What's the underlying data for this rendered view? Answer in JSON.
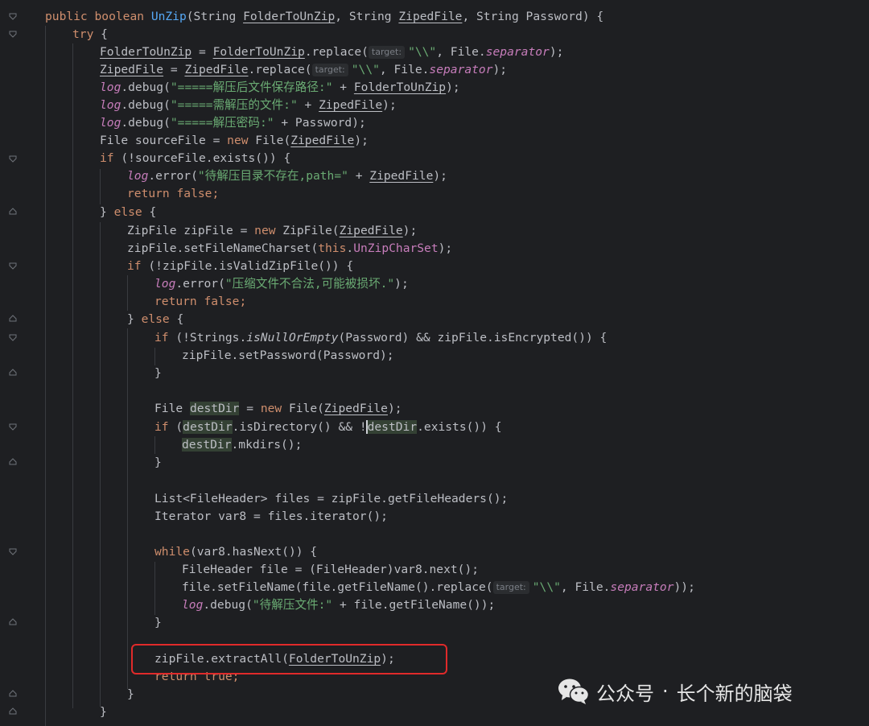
{
  "code": {
    "l1": {
      "kw1": "public",
      "kw2": "boolean",
      "fn": "UnZip",
      "p1": "(String ",
      "a1": "FolderToUnZip",
      "p2": ", String ",
      "a2": "ZipedFile",
      "p3": ", String Password) {"
    },
    "l2": {
      "kw": "try",
      "rest": " {"
    },
    "l3": {
      "v1": "FolderToUnZip",
      "p1": " = ",
      "v2": "FolderToUnZip",
      "p2": ".replace(",
      "hint": "target:",
      "s": "\"\\\\\"",
      "p3": ", File.",
      "f": "separator",
      "p4": ");"
    },
    "l4": {
      "v1": "ZipedFile",
      "p1": " = ",
      "v2": "ZipedFile",
      "p2": ".replace(",
      "hint": "target:",
      "s": "\"\\\\\"",
      "p3": ", File.",
      "f": "separator",
      "p4": ");"
    },
    "l5": {
      "log": "log",
      "m": ".debug(",
      "s": "\"=====解压后文件保存路径:\"",
      "p": " + ",
      "v": "FolderToUnZip",
      "e": ");"
    },
    "l6": {
      "log": "log",
      "m": ".debug(",
      "s": "\"=====需解压的文件:\"",
      "p": " + ",
      "v": "ZipedFile",
      "e": ");"
    },
    "l7": {
      "log": "log",
      "m": ".debug(",
      "s": "\"=====解压密码:\"",
      "p": " + Password);"
    },
    "l8": {
      "p1": "File sourceFile = ",
      "kw": "new",
      "p2": " File(",
      "v": "ZipedFile",
      "e": ");"
    },
    "l9": {
      "kw": "if",
      "p": " (!sourceFile.exists()) {"
    },
    "l10": {
      "log": "log",
      "m": ".error(",
      "s": "\"待解压目录不存在,path=\"",
      "p": " + ",
      "v": "ZipedFile",
      "e": ");"
    },
    "l11": {
      "kw1": "return",
      "kw2": "false",
      "e": ";"
    },
    "l12": {
      "p1": "} ",
      "kw": "else",
      "p2": " {"
    },
    "l13": {
      "p1": "ZipFile zipFile = ",
      "kw": "new",
      "p2": " ZipFile(",
      "v": "ZipedFile",
      "e": ");"
    },
    "l14": {
      "p1": "zipFile.setFileNameCharset(",
      "kw": "this",
      "p2": ".",
      "f": "UnZipCharSet",
      "e": ");"
    },
    "l15": {
      "kw": "if",
      "p": " (!zipFile.isValidZipFile()) {"
    },
    "l16": {
      "log": "log",
      "m": ".error(",
      "s": "\"压缩文件不合法,可能被损坏.\"",
      "e": ");"
    },
    "l17": {
      "kw1": "return",
      "kw2": "false",
      "e": ";"
    },
    "l18": {
      "p1": "} ",
      "kw": "else",
      "p2": " {"
    },
    "l19": {
      "kw": "if",
      "p1": " (!Strings.",
      "it": "isNullOrEmpty",
      "p2": "(Password) && zipFile.isEncrypted()) {"
    },
    "l20": {
      "p": "zipFile.setPassword(Password);"
    },
    "l21": {
      "p": "}"
    },
    "l22": {
      "p1": "File ",
      "v": "destDir",
      "p2": " = ",
      "kw": "new",
      "p3": " File(",
      "v2": "ZipedFile",
      "e": ");"
    },
    "l23": {
      "kw": "if",
      "p1": " (",
      "v1": "destDir",
      "p2": ".isDirectory() && !",
      "v2": "destDir",
      "p3": ".exists()) {"
    },
    "l24": {
      "v": "destDir",
      "p": ".mkdirs();"
    },
    "l25": {
      "p": "}"
    },
    "l26": {
      "p": "List<FileHeader> files = zipFile.getFileHeaders();"
    },
    "l27": {
      "p": "Iterator var8 = files.iterator();"
    },
    "l28": {
      "kw": "while",
      "p": "(var8.hasNext()) {"
    },
    "l29": {
      "p": "FileHeader file = (FileHeader)var8.next();"
    },
    "l30": {
      "p1": "file.setFileName(file.getFileName().replace(",
      "hint": "target:",
      "s": "\"\\\\\"",
      "p2": ", File.",
      "f": "separator",
      "e": "));"
    },
    "l31": {
      "log": "log",
      "m": ".debug(",
      "s": "\"待解压文件:\"",
      "p": " + file.getFileName());"
    },
    "l32": {
      "p": "}"
    },
    "l33": {
      "p1": "zipFile.extractAll(",
      "v": "FolderToUnZip",
      "e": ");"
    },
    "l34": {
      "kw1": "return",
      "kw2": "true",
      "e": ";"
    },
    "l35": {
      "p": "}"
    },
    "l36": {
      "p": "}"
    }
  },
  "watermark": {
    "text1": "公众号",
    "dot": "·",
    "text2": "长个新的脑袋",
    "icon": "wechat-icon"
  },
  "colors": {
    "background": "#1e1f22",
    "keyword": "#cf8e6d",
    "string": "#6aab73",
    "field": "#c77dbb",
    "function": "#56a8f5",
    "highlight_box": "#e02a2a"
  }
}
